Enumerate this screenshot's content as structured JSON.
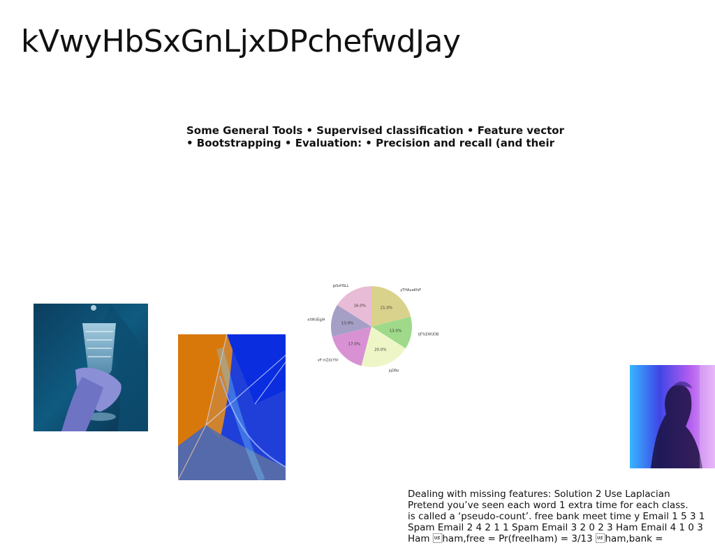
{
  "slide": {
    "title": "kVwyHbSxGnLjxDPchefwdJay",
    "tools_text": [
      "Some General Tools • Supervised classification • Feature vector",
      "• Bootstrapping • Evaluation: • Precision and recall (and their"
    ],
    "note_text": [
      "Dealing with missing features: Solution 2 Use Laplacian",
      "Pretend you’ve seen each word 1 extra time for each class.",
      "is called a ‘pseudo-count’. free bank meet time y Email 1 5 3 1",
      "Spam Email 2 4 2 1 1 Spam Email 3 2 0 2 3 Ham Email 4 1 0 3",
      "Ham \u001fham,free = Pr(freelham) = 3/13 \u001fham,bank ="
    ]
  },
  "images": [
    {
      "name": "photo-hand-glass",
      "description_icon": "hand-holding-glass-photo"
    },
    {
      "name": "photo-abstract-geometry",
      "description_icon": "abstract-glass-shapes-photo"
    },
    {
      "name": "photo-silhouette",
      "description_icon": "person-silhouette-photo"
    }
  ],
  "chart_data": {
    "type": "pie",
    "slices": [
      {
        "label": "yTHAuaKfsF",
        "value": 21.0,
        "pct_label": "21.0%",
        "color": "#d9d28c"
      },
      {
        "label": "tjF%EWUDB",
        "value": 13.0,
        "pct_label": "13.0%",
        "color": "#9fd98a"
      },
      {
        "label": "jqDRo",
        "value": 20.0,
        "pct_label": "20.0%",
        "color": "#eef6c8"
      },
      {
        "label": "vP mZdcYIV",
        "value": 17.0,
        "pct_label": "17.0%",
        "color": "#d892d3"
      },
      {
        "label": "bxtWUEgjH",
        "value": 13.0,
        "pct_label": "13.0%",
        "color": "#a59fc6"
      },
      {
        "label": "jpSzHSLL",
        "value": 16.0,
        "pct_label": "16.0%",
        "color": "#e8bcd6"
      }
    ],
    "start_angle_deg": 90,
    "direction": "clockwise"
  }
}
